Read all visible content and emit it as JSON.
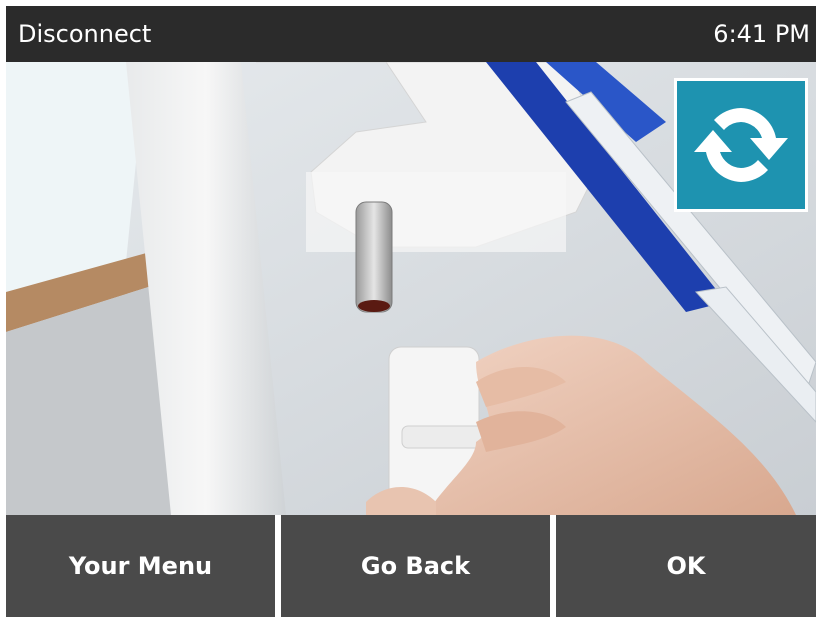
{
  "header": {
    "title": "Disconnect",
    "time": "6:41 PM"
  },
  "scene": {
    "description_icon": "connector-disconnect-illustration"
  },
  "refresh": {
    "icon": "refresh-icon",
    "color": "#1e93b0"
  },
  "footer": {
    "menu_label": "Your Menu",
    "back_label": "Go Back",
    "ok_label": "OK",
    "button_color": "#4a4a4a"
  }
}
